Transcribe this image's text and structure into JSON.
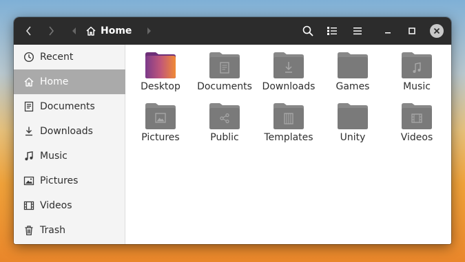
{
  "colors": {
    "headerbar": "#2c2c2c",
    "sidebar": "#f4f4f4",
    "sidebar_active": "#aaaaaa",
    "folder": "#7a7a7a",
    "folder_tab": "#888888",
    "desktop_folder_start": "#7b3a8a",
    "desktop_folder_end": "#f08a36"
  },
  "header": {
    "back_icon": "chevron-left-icon",
    "forward_icon": "chevron-right-icon",
    "path_left_icon": "triangle-left-icon",
    "path_home_icon": "home-icon",
    "path_label": "Home",
    "path_right_icon": "triangle-right-icon",
    "search_icon": "search-icon",
    "view_icon": "list-view-icon",
    "menu_icon": "hamburger-menu-icon",
    "minimize_icon": "minimize-icon",
    "maximize_icon": "maximize-icon",
    "close_icon": "close-icon"
  },
  "sidebar": {
    "items": [
      {
        "label": "Recent",
        "icon": "clock-icon"
      },
      {
        "label": "Home",
        "icon": "home-icon",
        "active": true
      },
      {
        "label": "Documents",
        "icon": "document-icon"
      },
      {
        "label": "Downloads",
        "icon": "download-icon"
      },
      {
        "label": "Music",
        "icon": "music-note-icon"
      },
      {
        "label": "Pictures",
        "icon": "picture-icon"
      },
      {
        "label": "Videos",
        "icon": "film-icon"
      },
      {
        "label": "Trash",
        "icon": "trash-icon"
      }
    ]
  },
  "files": [
    {
      "label": "Desktop",
      "icon": "desktop-folder-icon"
    },
    {
      "label": "Documents",
      "icon": "documents-folder-icon"
    },
    {
      "label": "Downloads",
      "icon": "downloads-folder-icon"
    },
    {
      "label": "Games",
      "icon": "folder-icon"
    },
    {
      "label": "Music",
      "icon": "music-folder-icon"
    },
    {
      "label": "Pictures",
      "icon": "pictures-folder-icon"
    },
    {
      "label": "Public",
      "icon": "public-folder-icon"
    },
    {
      "label": "Templates",
      "icon": "templates-folder-icon"
    },
    {
      "label": "Unity",
      "icon": "folder-icon"
    },
    {
      "label": "Videos",
      "icon": "videos-folder-icon"
    }
  ]
}
